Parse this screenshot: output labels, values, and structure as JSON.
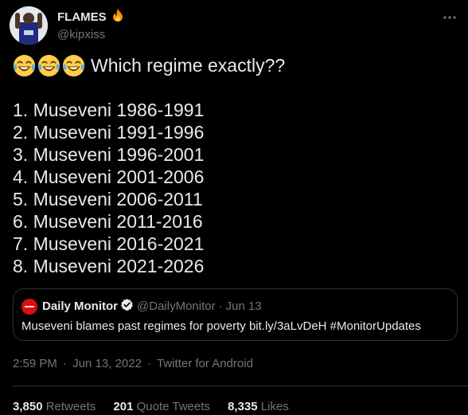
{
  "author": {
    "display_name": "FLAMES",
    "handle": "@kipxiss",
    "badge_icon": "fire-emoji"
  },
  "tweet": {
    "emoji": [
      "face-with-tears-of-joy",
      "face-with-tears-of-joy",
      "face-with-tears-of-joy"
    ],
    "headline": "Which regime exactly??",
    "list": [
      "1. Museveni 1986-1991",
      "2. Museveni 1991-1996",
      "3. Museveni 1996-2001",
      "4. Museveni 2001-2006",
      "5. Museveni 2006-2011",
      "6. Museveni 2011-2016",
      "7. Museveni 2016-2021",
      "8. Museveni 2021-2026"
    ]
  },
  "quote": {
    "display_name": "Daily Monitor",
    "handle": "@DailyMonitor",
    "separator": "·",
    "date": "Jun 13",
    "text": "Museveni blames past regimes for poverty bit.ly/3aLvDeH #MonitorUpdates"
  },
  "meta": {
    "time": "2:59 PM",
    "sep1": "·",
    "date": "Jun 13, 2022",
    "sep2": "·",
    "source": "Twitter for Android"
  },
  "stats": {
    "retweets_count": "3,850",
    "retweets_label": "Retweets",
    "quotes_count": "201",
    "quotes_label": "Quote Tweets",
    "likes_count": "8,335",
    "likes_label": "Likes"
  },
  "colors": {
    "background": "#000000",
    "text": "#e7e9ea",
    "muted": "#71767b",
    "border": "#2f3336",
    "verified": "#1d9bf0",
    "monitor_red": "#d90f13"
  }
}
